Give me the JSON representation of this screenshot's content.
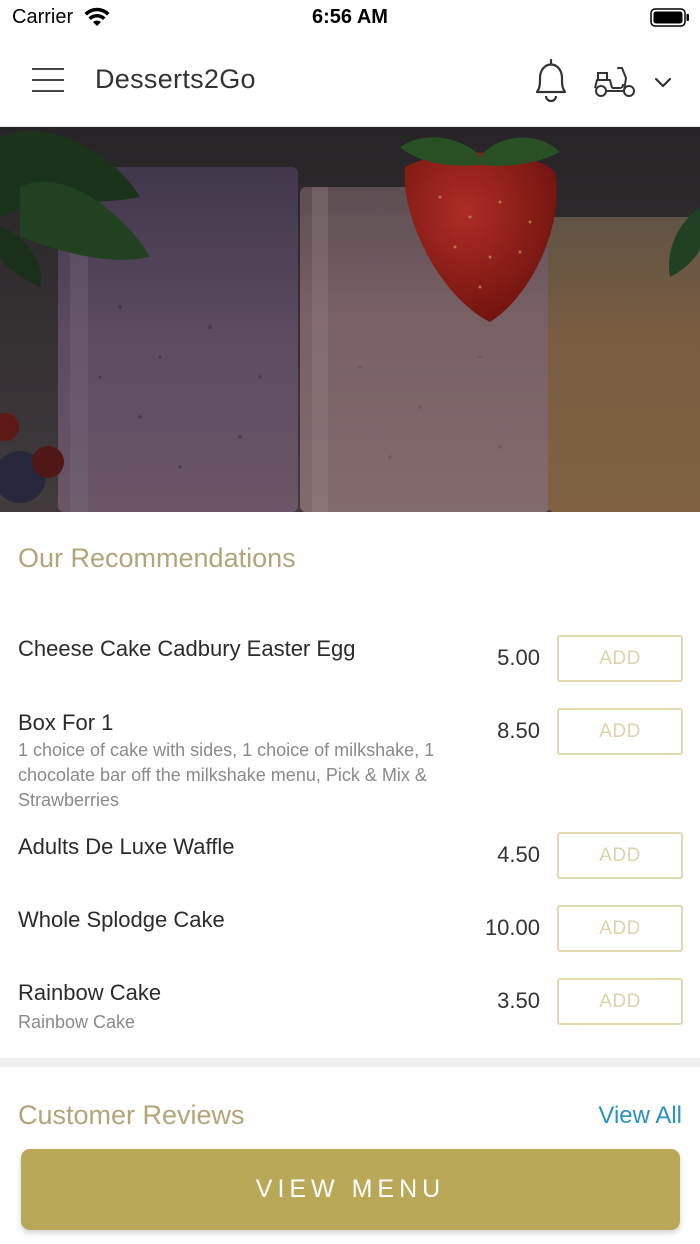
{
  "status_bar": {
    "carrier": "Carrier",
    "time": "6:56 AM"
  },
  "header": {
    "title": "Desserts2Go",
    "icons": [
      "hamburger-menu-icon",
      "bell-icon",
      "scooter-icon",
      "chevron-down-icon"
    ]
  },
  "hero": {
    "image": "milkshakes-with-strawberry-photo"
  },
  "recommendations": {
    "title": "Our Recommendations",
    "items": [
      {
        "name": "Cheese Cake Cadbury Easter Egg",
        "description": "",
        "price": "5.00",
        "add_label": "ADD"
      },
      {
        "name": "Box For 1",
        "description": "1 choice of cake with sides, 1 choice of milkshake, 1 chocolate bar off the milkshake menu, Pick & Mix & Strawberries",
        "price": "8.50",
        "add_label": "ADD"
      },
      {
        "name": "Adults De Luxe Waffle",
        "description": "",
        "price": "4.50",
        "add_label": "ADD"
      },
      {
        "name": "Whole Splodge Cake",
        "description": "",
        "price": "10.00",
        "add_label": "ADD"
      },
      {
        "name": "Rainbow Cake",
        "description": "Rainbow Cake",
        "price": "3.50",
        "add_label": "ADD"
      }
    ]
  },
  "reviews": {
    "title": "Customer Reviews",
    "view_all": "View All"
  },
  "footer": {
    "view_menu": "VIEW MENU"
  },
  "colors": {
    "accent_gold": "#b9a858",
    "section_title": "#b3a47a",
    "add_border": "#e2d8b0",
    "link_blue": "#2a91c0"
  }
}
